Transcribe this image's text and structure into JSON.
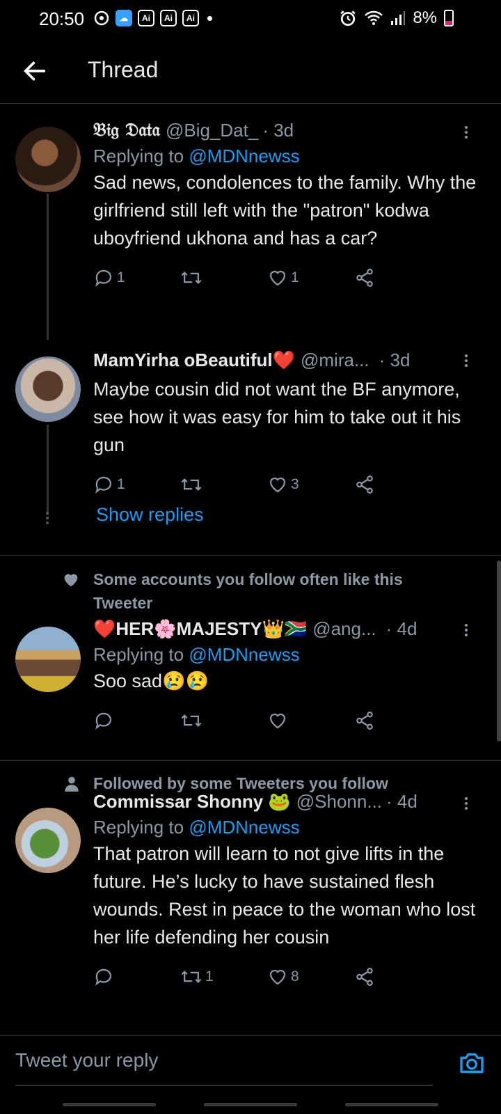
{
  "status_bar": {
    "time": "20:50",
    "apps": [
      "Ai",
      "Ai",
      "Ai"
    ],
    "battery": "8%"
  },
  "header": {
    "title": "Thread"
  },
  "tweets": [
    {
      "name": "𝔅𝔦𝔤 𝔇𝔞𝔱𝔞",
      "handle": "@Big_Dat_",
      "time": "· 3d",
      "replying_prefix": "Replying to ",
      "replying_to": "@MDNnewss",
      "text": "Sad news, condolences to the family. Why the girlfriend still left with the \"patron\" kodwa uboyfriend ukhona and has a car?",
      "replies": "1",
      "retweets": "",
      "likes": "1"
    },
    {
      "name": "MamYirha oBeautiful❤️",
      "handle": "@mira...",
      "time": "· 3d",
      "text": "Maybe cousin did not want the BF anymore, see how it was easy for him to take out it his gun",
      "replies": "1",
      "retweets": "",
      "likes": "3"
    },
    {
      "social_context": "Some accounts you follow often like this Tweeter",
      "name": "❤️HER🌸MAJESTY👑🇿🇦",
      "handle": "@ang...",
      "time": "· 4d",
      "replying_prefix": "Replying to ",
      "replying_to": "@MDNnewss",
      "text": "Soo sad😢😢",
      "replies": "",
      "retweets": "",
      "likes": ""
    },
    {
      "social_context": "Followed by some Tweeters you follow",
      "name": "Commissar Shonny 🐸",
      "handle": "@Shonn...",
      "time": "· 4d",
      "replying_prefix": "Replying to ",
      "replying_to": "@MDNnewss",
      "text": "That patron will learn to not give lifts in the future. He’s lucky to have sustained flesh wounds. Rest in peace to the woman who lost her life defending her cousin",
      "replies": "",
      "retweets": "1",
      "likes": "8"
    }
  ],
  "show_replies": "Show replies",
  "composer": {
    "placeholder": "Tweet your reply"
  },
  "colors": {
    "background": "#000000",
    "link": "#1d9bf0",
    "muted": "#8b98a5"
  }
}
